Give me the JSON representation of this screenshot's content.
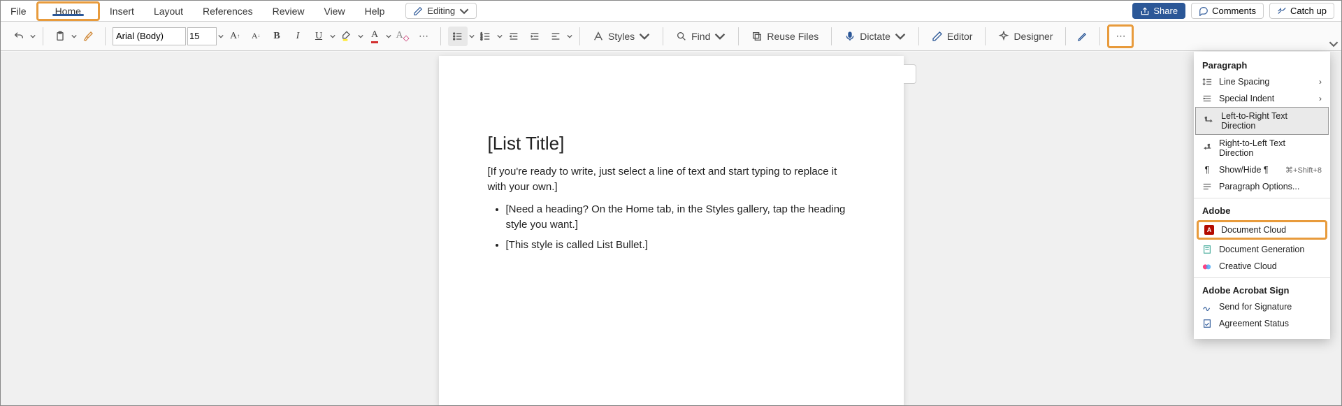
{
  "menu": {
    "tabs": [
      "File",
      "Home",
      "Insert",
      "Layout",
      "References",
      "Review",
      "View",
      "Help"
    ],
    "active_index": 1,
    "editing_label": "Editing"
  },
  "actions": {
    "share": "Share",
    "comments": "Comments",
    "catchup": "Catch up"
  },
  "toolbar": {
    "font_name": "Arial (Body)",
    "font_size": "15",
    "styles_label": "Styles",
    "find_label": "Find",
    "reuse_label": "Reuse Files",
    "dictate_label": "Dictate",
    "editor_label": "Editor",
    "designer_label": "Designer"
  },
  "document": {
    "title": "[List Title]",
    "intro": "[If you're ready to write, just select a line of text and start typing to replace it with your own.]",
    "bullets": [
      "[Need a heading? On the Home tab, in the Styles gallery, tap the heading style you want.]",
      "[This style is called List Bullet.]"
    ]
  },
  "dropdown": {
    "section1_title": "Paragraph",
    "line_spacing": "Line Spacing",
    "special_indent": "Special Indent",
    "ltr": "Left-to-Right Text Direction",
    "rtl": "Right-to-Left Text Direction",
    "showhide": "Show/Hide ¶",
    "showhide_shortcut": "⌘+Shift+8",
    "para_options": "Paragraph Options...",
    "section2_title": "Adobe",
    "doc_cloud": "Document Cloud",
    "doc_gen": "Document Generation",
    "creative_cloud": "Creative Cloud",
    "section3_title": "Adobe Acrobat Sign",
    "send_sig": "Send for Signature",
    "agreement": "Agreement Status"
  }
}
